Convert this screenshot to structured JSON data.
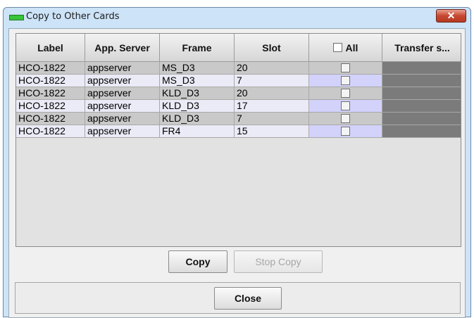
{
  "window": {
    "title": "Copy to Other Cards",
    "close_glyph": "✕"
  },
  "table": {
    "columns": [
      "Label",
      "App. Server",
      "Frame",
      "Slot",
      "All",
      "Transfer s..."
    ],
    "rows": [
      {
        "label": "HCO-1822",
        "server": "appserver",
        "frame": "MS_D3",
        "slot": "20"
      },
      {
        "label": "HCO-1822",
        "server": "appserver",
        "frame": "MS_D3",
        "slot": "7"
      },
      {
        "label": "HCO-1822",
        "server": "appserver",
        "frame": "KLD_D3",
        "slot": "20"
      },
      {
        "label": "HCO-1822",
        "server": "appserver",
        "frame": "KLD_D3",
        "slot": "17"
      },
      {
        "label": "HCO-1822",
        "server": "appserver",
        "frame": "KLD_D3",
        "slot": "7"
      },
      {
        "label": "HCO-1822",
        "server": "appserver",
        "frame": "FR4",
        "slot": "15"
      }
    ]
  },
  "buttons": {
    "copy": "Copy",
    "stop_copy": "Stop Copy",
    "close": "Close"
  },
  "icons": {
    "title_indicator": "green-status-led-icon",
    "close": "close-icon"
  },
  "colors": {
    "title_led": "#39c439",
    "close_button": "#c7472f",
    "transfer_status": "#7b7b7b"
  }
}
